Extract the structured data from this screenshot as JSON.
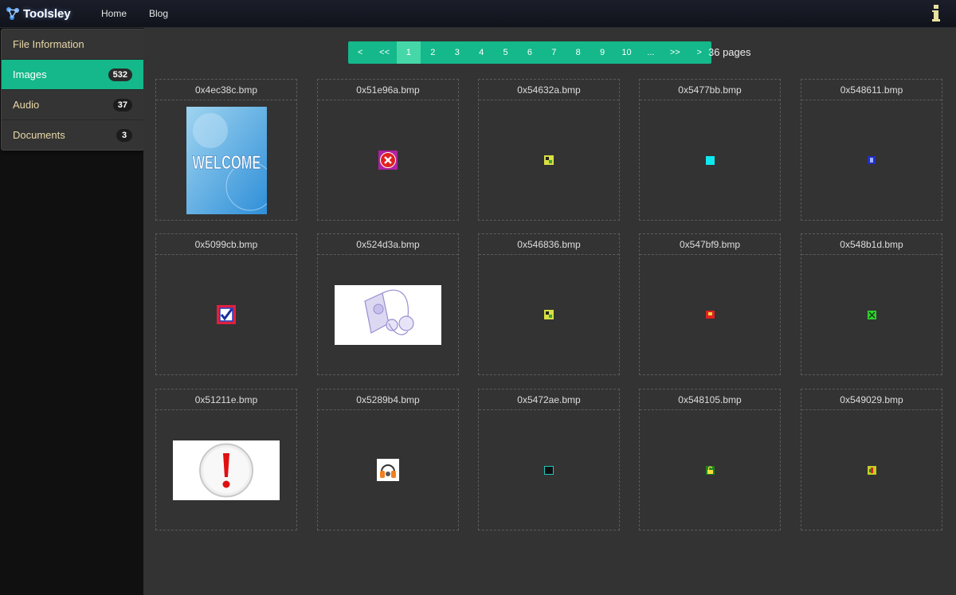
{
  "app": {
    "title": "Toolsley"
  },
  "nav": {
    "home": "Home",
    "blog": "Blog"
  },
  "sidebar": {
    "items": [
      {
        "label": "File Information",
        "count": ""
      },
      {
        "label": "Images",
        "count": "532",
        "active": true
      },
      {
        "label": "Audio",
        "count": "37"
      },
      {
        "label": "Documents",
        "count": "3"
      }
    ]
  },
  "pagination": {
    "prev": "<",
    "first": "<<",
    "pages": [
      "1",
      "2",
      "3",
      "4",
      "5",
      "6",
      "7",
      "8",
      "9",
      "10"
    ],
    "ellipsis": "...",
    "last": ">>",
    "next": ">",
    "current": "1",
    "total_label": "36 pages"
  },
  "files": [
    {
      "name": "0x4ec38c.bmp",
      "icon": "welcome-image"
    },
    {
      "name": "0x51e96a.bmp",
      "icon": "error-x-icon"
    },
    {
      "name": "0x54632a.bmp",
      "icon": "tiny-pixel-icon"
    },
    {
      "name": "0x5477bb.bmp",
      "icon": "cyan-square-icon"
    },
    {
      "name": "0x548611.bmp",
      "icon": "tiny-blue-icon"
    },
    {
      "name": "0x5099cb.bmp",
      "icon": "checkbox-icon"
    },
    {
      "name": "0x524d3a.bmp",
      "icon": "media-player-image"
    },
    {
      "name": "0x546836.bmp",
      "icon": "tiny-pixel-icon"
    },
    {
      "name": "0x547bf9.bmp",
      "icon": "tiny-red-icon"
    },
    {
      "name": "0x548b1d.bmp",
      "icon": "tiny-green-icon"
    },
    {
      "name": "0x51211e.bmp",
      "icon": "exclamation-image"
    },
    {
      "name": "0x5289b4.bmp",
      "icon": "headphones-icon"
    },
    {
      "name": "0x5472ae.bmp",
      "icon": "tiny-dark-icon"
    },
    {
      "name": "0x548105.bmp",
      "icon": "tiny-lock-icon"
    },
    {
      "name": "0x549029.bmp",
      "icon": "tiny-note-icon"
    }
  ],
  "colors": {
    "accent": "#14b88a",
    "accent_active": "#46d7a9",
    "main_bg": "#333333"
  }
}
